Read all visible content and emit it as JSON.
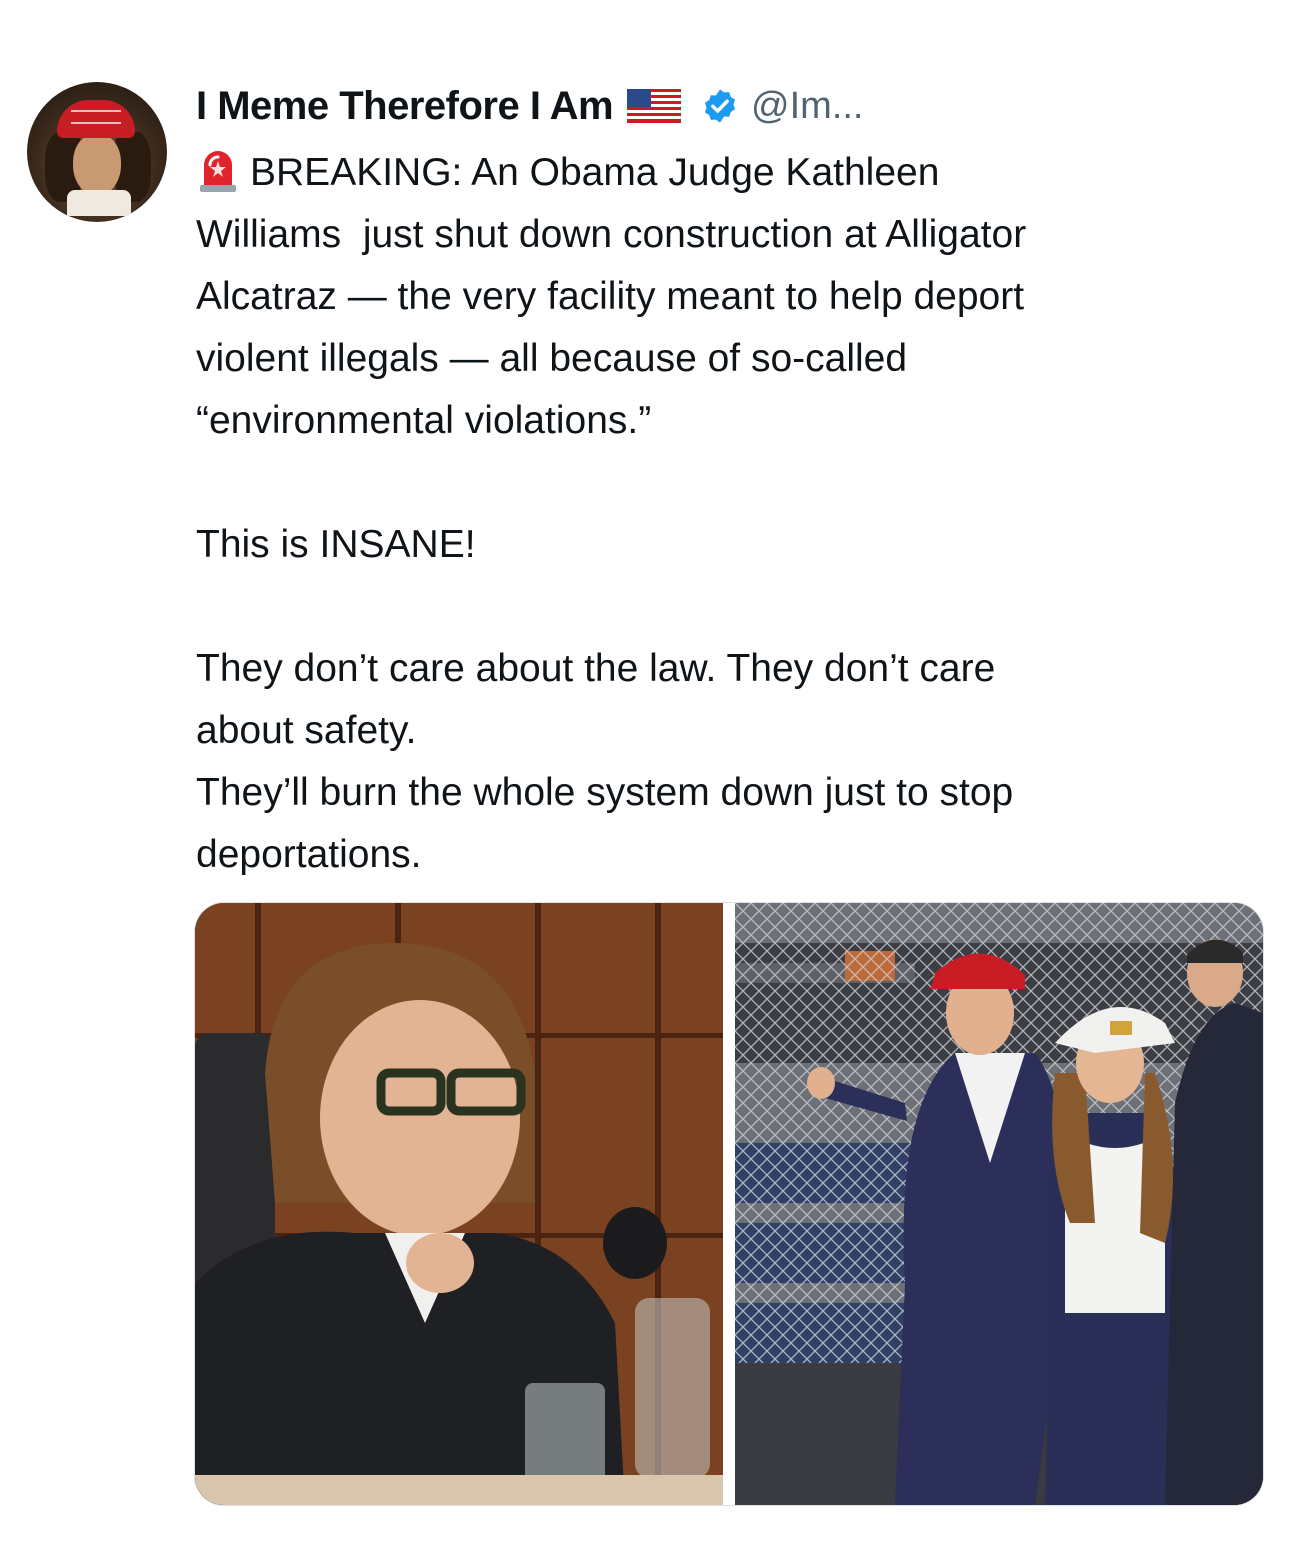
{
  "author": {
    "display_name": "I Meme Therefore I Am",
    "handle": "@Im...",
    "avatar": "avatar-man-red-cap",
    "badges": [
      "us-flag-icon",
      "verified-icon"
    ]
  },
  "tweet": {
    "icon": "siren-icon",
    "text": "BREAKING: An Obama Judge Kathleen\nWilliams  just shut down construction at Alligator\nAlcatraz — the very facility meant to help deport\nviolent illegals — all because of so-called\n“environmental violations.”\n\nThis is INSANE!\n\nThey don’t care about the law. They don’t care\nabout safety.\nThey’ll burn the whole system down just to stop\ndeportations."
  },
  "media": {
    "images": [
      {
        "name": "judge-photo",
        "description_icon": "photo-icon"
      },
      {
        "name": "facility-visit-photo",
        "description_icon": "photo-icon"
      }
    ]
  },
  "colors": {
    "text": "#0f1419",
    "secondary": "#536471",
    "verified": "#1d9bf0",
    "background": "#ffffff"
  }
}
